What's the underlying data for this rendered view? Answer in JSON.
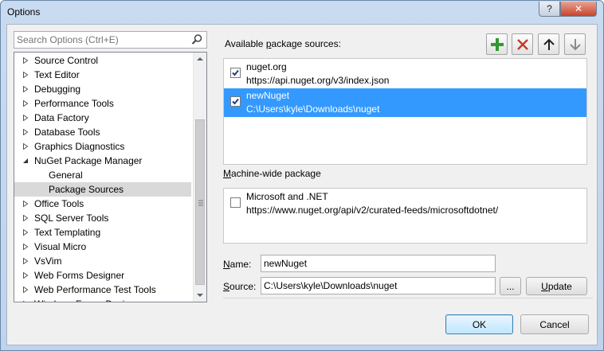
{
  "window": {
    "title": "Options",
    "help_glyph": "?",
    "close_glyph": "✕"
  },
  "search": {
    "placeholder": "Search Options (Ctrl+E)"
  },
  "tree": {
    "items": [
      {
        "label": "Source Control",
        "expanded": false
      },
      {
        "label": "Text Editor",
        "expanded": false
      },
      {
        "label": "Debugging",
        "expanded": false
      },
      {
        "label": "Performance Tools",
        "expanded": false
      },
      {
        "label": "Data Factory",
        "expanded": false
      },
      {
        "label": "Database Tools",
        "expanded": false
      },
      {
        "label": "Graphics Diagnostics",
        "expanded": false
      },
      {
        "label": "NuGet Package Manager",
        "expanded": true
      },
      {
        "label": "General",
        "child": true
      },
      {
        "label": "Package Sources",
        "child": true,
        "selected": true
      },
      {
        "label": "Office Tools",
        "expanded": false
      },
      {
        "label": "SQL Server Tools",
        "expanded": false
      },
      {
        "label": "Text Templating",
        "expanded": false
      },
      {
        "label": "Visual Micro",
        "expanded": false
      },
      {
        "label": "VsVim",
        "expanded": false
      },
      {
        "label": "Web Forms Designer",
        "expanded": false
      },
      {
        "label": "Web Performance Test Tools",
        "expanded": false
      },
      {
        "label": "Windows Forms Designer",
        "expanded": false
      }
    ]
  },
  "available": {
    "label_pre": "Available ",
    "label_ul": "p",
    "label_post": "ackage sources:",
    "sources": [
      {
        "name": "nuget.org",
        "url": "https://api.nuget.org/v3/index.json",
        "checked": true,
        "selected": false
      },
      {
        "name": "newNuget",
        "url": "C:\\Users\\kyle\\Downloads\\nuget",
        "checked": true,
        "selected": true
      }
    ]
  },
  "toolbar_icons": [
    "add-icon",
    "remove-icon",
    "move-up-icon",
    "move-down-icon"
  ],
  "machine": {
    "label_ul": "M",
    "label_post": "achine-wide package",
    "sources": [
      {
        "name": "Microsoft and .NET",
        "url": "https://www.nuget.org/api/v2/curated-feeds/microsoftdotnet/",
        "checked": false
      }
    ]
  },
  "form": {
    "name_label_ul": "N",
    "name_label_post": "ame:",
    "name_value": "newNuget",
    "source_label_ul": "S",
    "source_label_post": "ource:",
    "source_value": "C:\\Users\\kyle\\Downloads\\nuget",
    "browse_label": "...",
    "update_label_ul": "U",
    "update_label_post": "pdate"
  },
  "buttons": {
    "ok": "OK",
    "cancel": "Cancel"
  },
  "colors": {
    "selection": "#3399ff",
    "add_green": "#2f9a2f",
    "remove_red": "#c0392b"
  }
}
